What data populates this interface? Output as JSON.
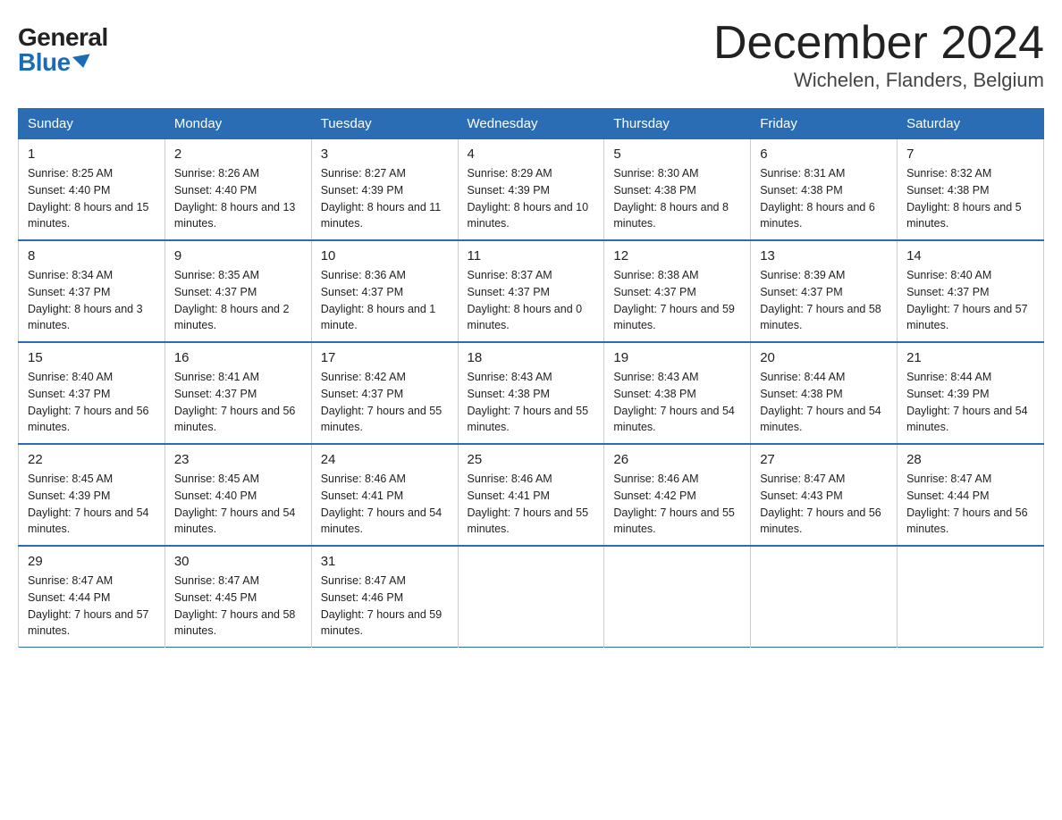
{
  "logo": {
    "general": "General",
    "blue": "Blue"
  },
  "title": "December 2024",
  "location": "Wichelen, Flanders, Belgium",
  "days_of_week": [
    "Sunday",
    "Monday",
    "Tuesday",
    "Wednesday",
    "Thursday",
    "Friday",
    "Saturday"
  ],
  "weeks": [
    [
      {
        "num": "1",
        "sunrise": "8:25 AM",
        "sunset": "4:40 PM",
        "daylight": "8 hours and 15 minutes."
      },
      {
        "num": "2",
        "sunrise": "8:26 AM",
        "sunset": "4:40 PM",
        "daylight": "8 hours and 13 minutes."
      },
      {
        "num": "3",
        "sunrise": "8:27 AM",
        "sunset": "4:39 PM",
        "daylight": "8 hours and 11 minutes."
      },
      {
        "num": "4",
        "sunrise": "8:29 AM",
        "sunset": "4:39 PM",
        "daylight": "8 hours and 10 minutes."
      },
      {
        "num": "5",
        "sunrise": "8:30 AM",
        "sunset": "4:38 PM",
        "daylight": "8 hours and 8 minutes."
      },
      {
        "num": "6",
        "sunrise": "8:31 AM",
        "sunset": "4:38 PM",
        "daylight": "8 hours and 6 minutes."
      },
      {
        "num": "7",
        "sunrise": "8:32 AM",
        "sunset": "4:38 PM",
        "daylight": "8 hours and 5 minutes."
      }
    ],
    [
      {
        "num": "8",
        "sunrise": "8:34 AM",
        "sunset": "4:37 PM",
        "daylight": "8 hours and 3 minutes."
      },
      {
        "num": "9",
        "sunrise": "8:35 AM",
        "sunset": "4:37 PM",
        "daylight": "8 hours and 2 minutes."
      },
      {
        "num": "10",
        "sunrise": "8:36 AM",
        "sunset": "4:37 PM",
        "daylight": "8 hours and 1 minute."
      },
      {
        "num": "11",
        "sunrise": "8:37 AM",
        "sunset": "4:37 PM",
        "daylight": "8 hours and 0 minutes."
      },
      {
        "num": "12",
        "sunrise": "8:38 AM",
        "sunset": "4:37 PM",
        "daylight": "7 hours and 59 minutes."
      },
      {
        "num": "13",
        "sunrise": "8:39 AM",
        "sunset": "4:37 PM",
        "daylight": "7 hours and 58 minutes."
      },
      {
        "num": "14",
        "sunrise": "8:40 AM",
        "sunset": "4:37 PM",
        "daylight": "7 hours and 57 minutes."
      }
    ],
    [
      {
        "num": "15",
        "sunrise": "8:40 AM",
        "sunset": "4:37 PM",
        "daylight": "7 hours and 56 minutes."
      },
      {
        "num": "16",
        "sunrise": "8:41 AM",
        "sunset": "4:37 PM",
        "daylight": "7 hours and 56 minutes."
      },
      {
        "num": "17",
        "sunrise": "8:42 AM",
        "sunset": "4:37 PM",
        "daylight": "7 hours and 55 minutes."
      },
      {
        "num": "18",
        "sunrise": "8:43 AM",
        "sunset": "4:38 PM",
        "daylight": "7 hours and 55 minutes."
      },
      {
        "num": "19",
        "sunrise": "8:43 AM",
        "sunset": "4:38 PM",
        "daylight": "7 hours and 54 minutes."
      },
      {
        "num": "20",
        "sunrise": "8:44 AM",
        "sunset": "4:38 PM",
        "daylight": "7 hours and 54 minutes."
      },
      {
        "num": "21",
        "sunrise": "8:44 AM",
        "sunset": "4:39 PM",
        "daylight": "7 hours and 54 minutes."
      }
    ],
    [
      {
        "num": "22",
        "sunrise": "8:45 AM",
        "sunset": "4:39 PM",
        "daylight": "7 hours and 54 minutes."
      },
      {
        "num": "23",
        "sunrise": "8:45 AM",
        "sunset": "4:40 PM",
        "daylight": "7 hours and 54 minutes."
      },
      {
        "num": "24",
        "sunrise": "8:46 AM",
        "sunset": "4:41 PM",
        "daylight": "7 hours and 54 minutes."
      },
      {
        "num": "25",
        "sunrise": "8:46 AM",
        "sunset": "4:41 PM",
        "daylight": "7 hours and 55 minutes."
      },
      {
        "num": "26",
        "sunrise": "8:46 AM",
        "sunset": "4:42 PM",
        "daylight": "7 hours and 55 minutes."
      },
      {
        "num": "27",
        "sunrise": "8:47 AM",
        "sunset": "4:43 PM",
        "daylight": "7 hours and 56 minutes."
      },
      {
        "num": "28",
        "sunrise": "8:47 AM",
        "sunset": "4:44 PM",
        "daylight": "7 hours and 56 minutes."
      }
    ],
    [
      {
        "num": "29",
        "sunrise": "8:47 AM",
        "sunset": "4:44 PM",
        "daylight": "7 hours and 57 minutes."
      },
      {
        "num": "30",
        "sunrise": "8:47 AM",
        "sunset": "4:45 PM",
        "daylight": "7 hours and 58 minutes."
      },
      {
        "num": "31",
        "sunrise": "8:47 AM",
        "sunset": "4:46 PM",
        "daylight": "7 hours and 59 minutes."
      },
      null,
      null,
      null,
      null
    ]
  ],
  "labels": {
    "sunrise": "Sunrise:",
    "sunset": "Sunset:",
    "daylight": "Daylight:"
  }
}
